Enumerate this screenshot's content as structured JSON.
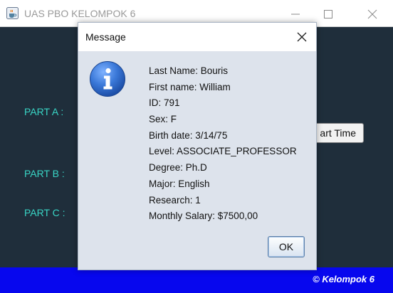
{
  "window": {
    "title": "UAS PBO KELOMPOK 6",
    "icons": {
      "app": "java-cup-icon",
      "minimize": "minimize-icon",
      "maximize": "maximize-icon",
      "close": "close-icon"
    }
  },
  "main": {
    "labels": {
      "part_a": "PART A :",
      "part_b": "PART B :",
      "part_c": "PART C :"
    },
    "partial_button_label": "art Time",
    "footer": "© Kelompok 6",
    "colors": {
      "panel_bg": "#1f2e3b",
      "label_text": "#39d6c6",
      "footer_bg": "#0707ee"
    }
  },
  "dialog": {
    "title": "Message",
    "icon": "info-icon",
    "lines": [
      "Last Name: Bouris",
      "First name: William",
      "ID: 791",
      "Sex: F",
      "Birth date: 3/14/75",
      "Level: ASSOCIATE_PROFESSOR",
      "Degree: Ph.D",
      "Major: English",
      "Research: 1",
      "Monthly Salary: $7500,00"
    ],
    "ok_label": "OK"
  }
}
